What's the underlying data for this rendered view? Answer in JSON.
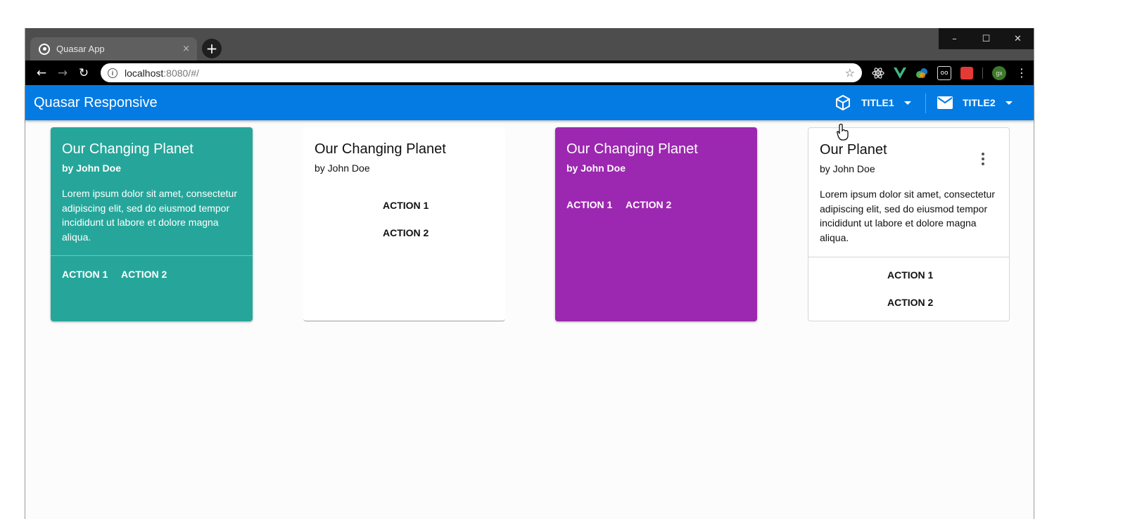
{
  "browser": {
    "tab_title": "Quasar App",
    "tab_close": "×",
    "new_tab": "+",
    "url_host": "localhost",
    "url_rest": ":8080/#/",
    "window_buttons": [
      "–",
      "☐",
      "✕"
    ],
    "profile_initials": "gx"
  },
  "app": {
    "title": "Quasar Responsive",
    "header_buttons": [
      {
        "label": "TITLE1",
        "icon": "cube-icon"
      },
      {
        "label": "TITLE2",
        "icon": "mail-icon"
      }
    ]
  },
  "cards": [
    {
      "title": "Our Changing Planet",
      "subtitle": "by John Doe",
      "body": "Lorem ipsum dolor sit amet, consectetur adipiscing elit, sed do eiusmod tempor incididunt ut labore et dolore magna aliqua.",
      "actions": [
        "ACTION 1",
        "ACTION 2"
      ],
      "color": "#26a69a"
    },
    {
      "title": "Our Changing Planet",
      "subtitle": "by John Doe",
      "actions": [
        "ACTION 1",
        "ACTION 2"
      ],
      "color": "#ffffff"
    },
    {
      "title": "Our Changing Planet",
      "subtitle": "by John Doe",
      "actions": [
        "ACTION 1",
        "ACTION 2"
      ],
      "color": "#9c27b0"
    },
    {
      "title": "Our Planet",
      "subtitle": "by John Doe",
      "body": "Lorem ipsum dolor sit amet, consectetur adipiscing elit, sed do eiusmod tempor incididunt ut labore et dolore magna aliqua.",
      "actions": [
        "ACTION 1",
        "ACTION 2"
      ],
      "color": "#ffffff",
      "menu_icon": "more-vert-icon"
    }
  ],
  "colors": {
    "primary": "#037be3",
    "teal": "#26a69a",
    "purple": "#9c27b0"
  }
}
